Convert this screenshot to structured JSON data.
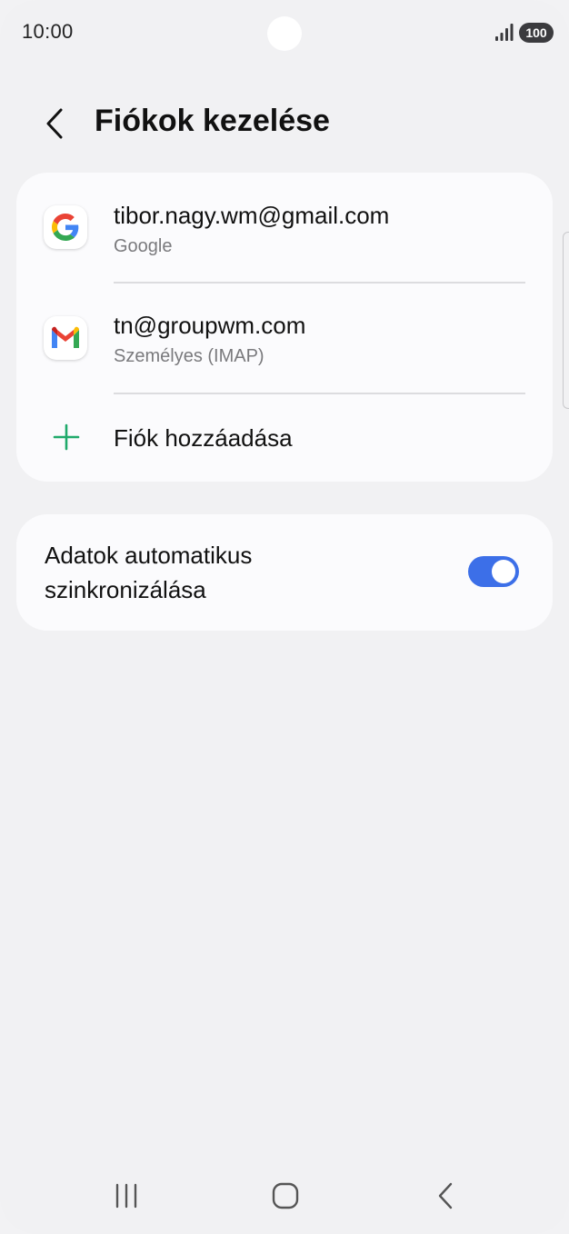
{
  "status_bar": {
    "time": "10:00",
    "battery": "100",
    "signal_icon": "signal-bars-icon"
  },
  "header": {
    "back_icon": "chevron-left-icon",
    "title": "Fiókok kezelése"
  },
  "accounts": [
    {
      "email": "tibor.nagy.wm@gmail.com",
      "type": "Google",
      "icon": "google-icon"
    },
    {
      "email": "tn@groupwm.com",
      "type": "Személyes (IMAP)",
      "icon": "gmail-icon"
    }
  ],
  "add_account": {
    "label": "Fiók hozzáadása",
    "icon": "plus-icon",
    "icon_color": "#1faa6b"
  },
  "sync": {
    "label": "Adatok automatikus szinkronizálása",
    "enabled": true,
    "toggle_color": "#3c6fe8"
  },
  "nav_bar": {
    "recent_icon": "recent-apps-icon",
    "home_icon": "home-icon",
    "back_icon": "back-icon"
  }
}
